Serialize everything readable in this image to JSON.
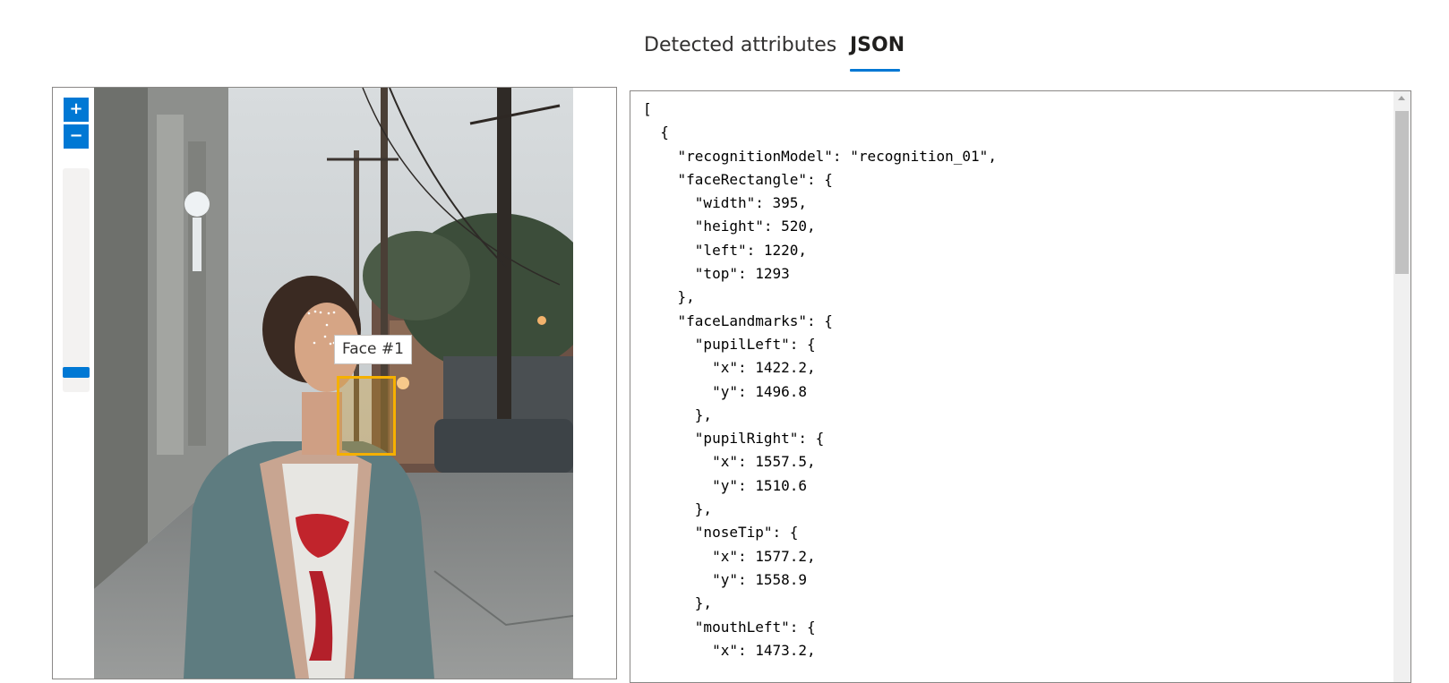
{
  "tabs": [
    {
      "label": "Detected attributes",
      "active": false
    },
    {
      "label": "JSON",
      "active": true
    }
  ],
  "viewer": {
    "zoom_in_label": "+",
    "zoom_out_label": "−",
    "face_label": "Face #1"
  },
  "json_lines": [
    "[",
    "  {",
    "    \"recognitionModel\": \"recognition_01\",",
    "    \"faceRectangle\": {",
    "      \"width\": 395,",
    "      \"height\": 520,",
    "      \"left\": 1220,",
    "      \"top\": 1293",
    "    },",
    "    \"faceLandmarks\": {",
    "      \"pupilLeft\": {",
    "        \"x\": 1422.2,",
    "        \"y\": 1496.8",
    "      },",
    "      \"pupilRight\": {",
    "        \"x\": 1557.5,",
    "        \"y\": 1510.6",
    "      },",
    "      \"noseTip\": {",
    "        \"x\": 1577.2,",
    "        \"y\": 1558.9",
    "      },",
    "      \"mouthLeft\": {",
    "        \"x\": 1473.2,"
  ],
  "colors": {
    "accent": "#0078d4",
    "face_box": "#f5b000"
  },
  "icons": [
    "zoom-in-icon",
    "zoom-out-icon"
  ]
}
